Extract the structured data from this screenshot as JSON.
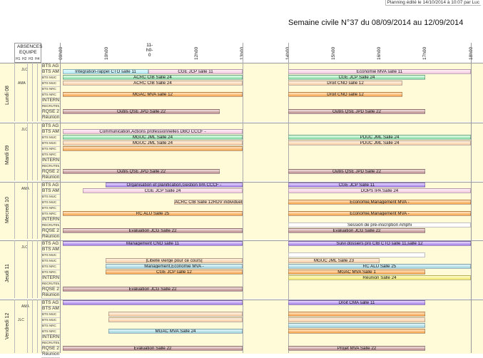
{
  "header": {
    "edited": "Planning édité le 14/10/2014 à 10:07 par Luc",
    "title": "Semaine civile N°37 du 08/09/2014 au 12/09/2014",
    "absences_label": "ABSENCES",
    "equipe_label": "EQUIPE",
    "cols": [
      "H1",
      "H2",
      "H3",
      "H4"
    ]
  },
  "hours": [
    "09h00",
    "10h00",
    "11-\nh0-\n0",
    "12h00",
    "13h00",
    "14h00",
    "15h00",
    "16h00",
    "17h00",
    "18h00"
  ],
  "hours_text": {
    "h09": "09h00",
    "h10": "10h00",
    "h11a": "11-",
    "h11b": "h0-",
    "h11c": "0",
    "h12": "12h00",
    "h13": "13h00",
    "h14": "14h00",
    "h15": "15h00",
    "h16": "16h00",
    "h17": "17h00",
    "h18": "18h00"
  },
  "row_labels": {
    "r0": "BTS AG 2",
    "r1": "BTS AM 2",
    "r2": "BTS MUC",
    "r3": "BTS MUC",
    "r4": "BTS NRC",
    "r5": "BTS NRC",
    "r6": "INTERNE",
    "r7": "RECRUTEME",
    "r8": "RQSE 2",
    "r9": "Réunions"
  },
  "days": [
    {
      "name": "Lundi 08",
      "abs1": "JLC",
      "abs2": "AMA"
    },
    {
      "name": "Mardi 09",
      "abs1": "JLC",
      "abs2": ""
    },
    {
      "name": "Mercredi 10",
      "abs1": "AMA",
      "abs2": ""
    },
    {
      "name": "Jeudi 11",
      "abs1": "JLC",
      "abs2": ""
    },
    {
      "name": "Vendredi 12",
      "abs1": "AMA",
      "abs2": "JLC"
    }
  ],
  "events": {
    "l1": "Intégration-rappel CTO salle 11",
    "l2": "CGE JCP salle 11",
    "l3": "Economie MVA salle 11",
    "l4": "ACRC CIB Salle 24",
    "l5": "CGE JCP Salle 24",
    "l6": "ACRC CIB Salle 24",
    "l7": "Droit CNO salle 12",
    "l8": "MGAC MVA salle 12",
    "l9": "Droit CNO salle 12",
    "l10": "Outils QSE JPD Salle 22",
    "l11": "Outils QSE JPD Salle 22",
    "m1": "Communication,Actions professionnelles DBO CCCF -",
    "m2": "MGUC JML Salle 24",
    "m3": "PDUC JML Salle 24",
    "m4": "MGUC JML Salle 24",
    "m5": "PDUC JML Salle 24",
    "m6": "Outils QSE JPD Salle 22",
    "m7": "Outils QSE JPD Salle 22",
    "w1": "Organisation et planification,Gestion IPA CCCF -",
    "w2": "CGE JCP Salle 11",
    "w3": "CGE JCP Salle 24",
    "w4": "DOPS IPA Salle 24",
    "w5": "ACRC CIB Salle 12RDV individuels",
    "w6": "Economie,Management MVA -",
    "w7": "RC ALU Salle 25",
    "w8": "Economie,Management MVA -",
    "w9": "Session de pré-inscription Amphi",
    "w10": "Evaluation JCG Salle 22",
    "w11": "Evaluation JCG Salle 22",
    "j1": "Management CNO salle 11",
    "j2": "Suivi dossiers pro CIB CTO salle 11,salle 12",
    "j3": "[Libellé vierge pour ce cours]",
    "j4": "MGUC JML Salle 23",
    "j5": "Management,Economie MVA -",
    "j6": "RC ALU Salle 25",
    "j7": "CGE JCP salle 12",
    "j8": "MGAC MVA Salle 1",
    "j9": "Réunion Salle 24",
    "j10": "Evaluation JCG Salle 22",
    "v1": "Droit CMA salle 11",
    "v2": "MGAC MVA Salle 24",
    "v3": "Evaluation Salle 22",
    "v4": "Projet MVA Salle 22"
  }
}
